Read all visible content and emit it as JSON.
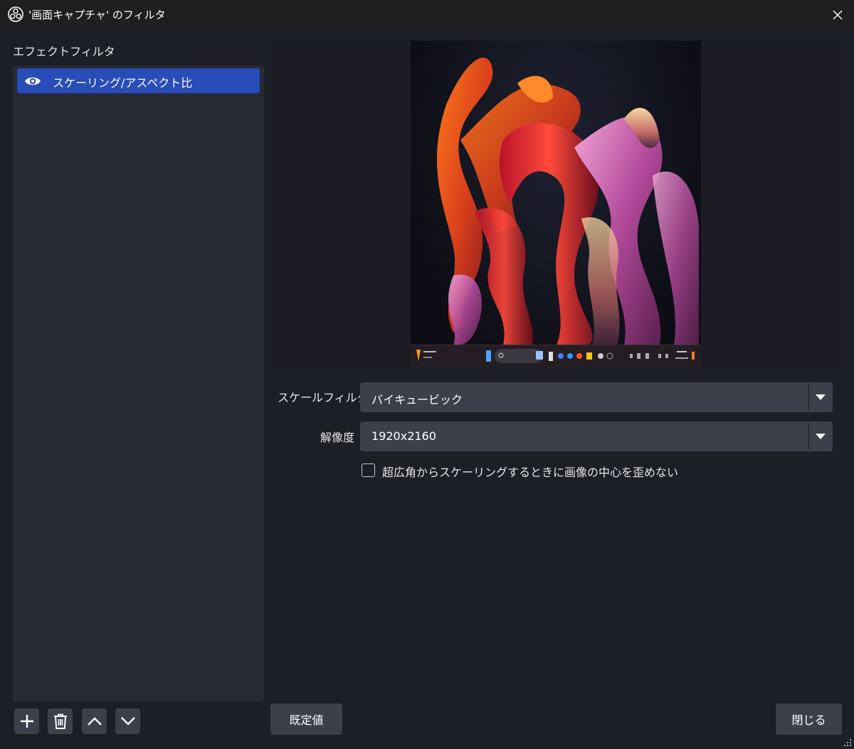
{
  "window": {
    "title": "'画面キャプチャ' のフィルタ",
    "app_icon": "obs-logo-icon",
    "close_icon": "close-icon"
  },
  "filters_panel": {
    "label": "エフェクトフィルタ",
    "items": [
      {
        "label": "スケーリング/アスペクト比",
        "visible": true,
        "selected": true,
        "icon": "eye-icon"
      }
    ],
    "toolbar": [
      {
        "name": "add-filter",
        "icon": "plus-icon"
      },
      {
        "name": "remove-filter",
        "icon": "trash-icon"
      },
      {
        "name": "move-up",
        "icon": "chevron-up-icon"
      },
      {
        "name": "move-down",
        "icon": "chevron-down-icon"
      }
    ]
  },
  "properties": {
    "scale_filter": {
      "label": "スケールフィルタ",
      "value": "バイキュービック"
    },
    "resolution": {
      "label": "解像度",
      "value": "1920x2160"
    },
    "undistort": {
      "label": "超広角からスケーリングするときに画像の中心を歪めない",
      "checked": false
    }
  },
  "buttons": {
    "defaults": "既定値",
    "close": "閉じる"
  },
  "colors": {
    "selection": "#284cb8",
    "panel": "#272a33",
    "background": "#1d1f26",
    "control": "#3c404b"
  }
}
